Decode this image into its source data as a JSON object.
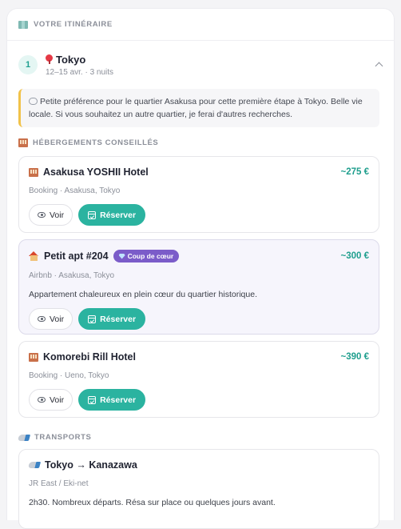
{
  "header": {
    "title": "VOTRE ITINÉRAIRE"
  },
  "day": {
    "number": "1",
    "city": "Tokyo",
    "subtitle": "12–15 avr. · 3 nuits"
  },
  "note": {
    "text": "Petite préférence pour le quartier Asakusa pour cette première étape à Tokyo. Belle vie locale. Si vous souhaitez un autre quartier, je ferai d'autres recherches."
  },
  "lodging": {
    "section_title": "HÉBERGEMENTS CONSEILLÉS",
    "cards": [
      {
        "name": "Asakusa YOSHII Hotel",
        "price": "~275 €",
        "meta": "Booking · Asakusa, Tokyo",
        "view_label": "Voir",
        "book_label": "Réserver"
      },
      {
        "name": "Petit apt #204",
        "badge": "Coup de cœur",
        "price": "~300 €",
        "meta": "Airbnb · Asakusa, Tokyo",
        "description": "Appartement chaleureux en plein cœur du quartier historique.",
        "view_label": "Voir",
        "book_label": "Réserver"
      },
      {
        "name": "Komorebi Rill Hotel",
        "price": "~390 €",
        "meta": "Booking · Ueno, Tokyo",
        "view_label": "Voir",
        "book_label": "Réserver"
      }
    ]
  },
  "transport": {
    "section_title": "TRANSPORTS",
    "card": {
      "route": "Tokyo → Kanazawa",
      "meta": "JR East / Eki-net",
      "description": "2h30. Nombreux départs. Résa sur place ou quelques jours avant."
    }
  },
  "icons": [
    "map-icon",
    "pin-icon",
    "chevron-up-icon",
    "speech-bubble-icon",
    "hotel-icon",
    "house-icon",
    "gem-icon",
    "eye-icon",
    "calendar-check-icon",
    "train-icon"
  ],
  "colors": {
    "accent": "#2bb3a0",
    "price": "#1e9e8d",
    "badge": "#7b5cc9",
    "note_border": "#f1c24a"
  }
}
